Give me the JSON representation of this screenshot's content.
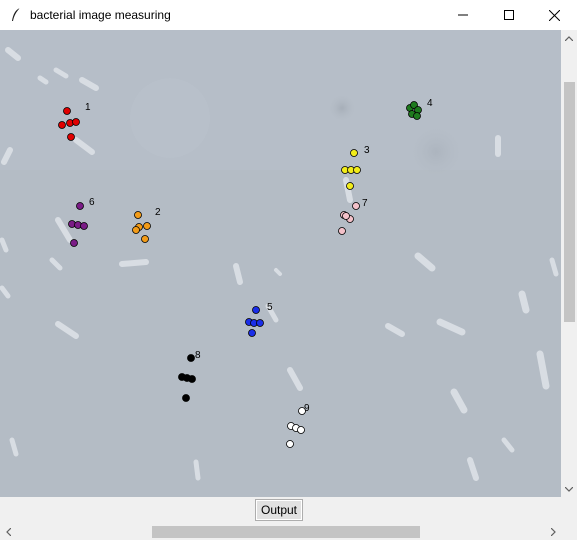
{
  "window": {
    "title": "bacterial image measuring",
    "icon": "feather-icon"
  },
  "controls": {
    "minimize_icon": "minimize-icon",
    "maximize_icon": "maximize-icon",
    "close_icon": "close-icon"
  },
  "canvas": {
    "background": "#b4bcc5",
    "marker_groups": [
      {
        "label": "1",
        "color": "#e00000"
      },
      {
        "label": "2",
        "color": "#f29b18"
      },
      {
        "label": "3",
        "color": "#f2ec1a"
      },
      {
        "label": "4",
        "color": "#1e7a1e"
      },
      {
        "label": "5",
        "color": "#1a2ee8"
      },
      {
        "label": "6",
        "color": "#7a1c86"
      },
      {
        "label": "7",
        "color": "#f3c1c9"
      },
      {
        "label": "8",
        "color": "#000000"
      },
      {
        "label": "9",
        "color": "#ffffff"
      }
    ]
  },
  "buttons": {
    "output_label": "Output"
  }
}
